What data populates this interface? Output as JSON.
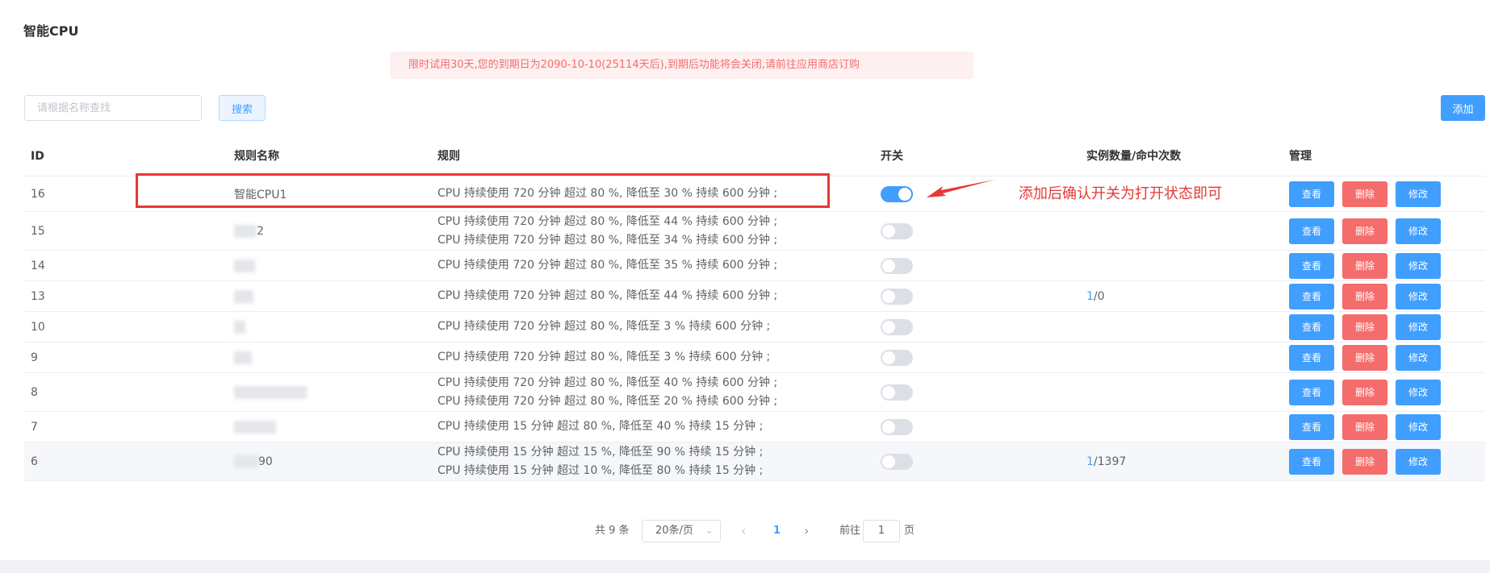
{
  "page": {
    "title": "智能CPU"
  },
  "notice": {
    "text": "限时试用30天,您的到期日为2090-10-10(25114天后),到期后功能将会关闭,请前往应用商店订购"
  },
  "toolbar": {
    "search_placeholder": "请根据名称查找",
    "search_value": "",
    "search_label": "搜索",
    "add_label": "添加"
  },
  "table": {
    "headers": {
      "id": "ID",
      "name": "规则名称",
      "rule": "规则",
      "switch": "开关",
      "count": "实例数量/命中次数",
      "ops": "管理"
    },
    "op_labels": {
      "view": "查看",
      "delete": "删除",
      "edit": "修改"
    },
    "rows": [
      {
        "id": "16",
        "name": "智能CPU1",
        "name_blurred": false,
        "rules": [
          "CPU 持续使用 720 分钟 超过 80 %, 降低至 30 % 持续 600 分钟 ;"
        ],
        "switch_on": true,
        "count_hit": "",
        "count_rest": ""
      },
      {
        "id": "15",
        "name": "2",
        "name_blurred": true,
        "rules": [
          "CPU 持续使用 720 分钟 超过 80 %, 降低至 44 % 持续 600 分钟 ;",
          "CPU 持续使用 720 分钟 超过 80 %, 降低至 34 % 持续 600 分钟 ;"
        ],
        "switch_on": false,
        "count_hit": "",
        "count_rest": ""
      },
      {
        "id": "14",
        "name": "",
        "name_blurred": true,
        "rules": [
          "CPU 持续使用 720 分钟 超过 80 %, 降低至 35 % 持续 600 分钟 ;"
        ],
        "switch_on": false,
        "count_hit": "",
        "count_rest": ""
      },
      {
        "id": "13",
        "name": "",
        "name_blurred": true,
        "rules": [
          "CPU 持续使用 720 分钟 超过 80 %, 降低至 44 % 持续 600 分钟 ;"
        ],
        "switch_on": false,
        "count_hit": "1",
        "count_rest": "/0"
      },
      {
        "id": "10",
        "name": "",
        "name_blurred": true,
        "rules": [
          "CPU 持续使用 720 分钟 超过 80 %, 降低至 3 % 持续 600 分钟 ;"
        ],
        "switch_on": false,
        "count_hit": "",
        "count_rest": ""
      },
      {
        "id": "9",
        "name": "",
        "name_blurred": true,
        "rules": [
          "CPU 持续使用 720 分钟 超过 80 %, 降低至 3 % 持续 600 分钟 ;"
        ],
        "switch_on": false,
        "count_hit": "",
        "count_rest": ""
      },
      {
        "id": "8",
        "name": "",
        "name_blurred": true,
        "rules": [
          "CPU 持续使用 720 分钟 超过 80 %, 降低至 40 % 持续 600 分钟 ;",
          "CPU 持续使用 720 分钟 超过 80 %, 降低至 20 % 持续 600 分钟 ;"
        ],
        "switch_on": false,
        "count_hit": "",
        "count_rest": ""
      },
      {
        "id": "7",
        "name": "",
        "name_blurred": true,
        "rules": [
          "CPU 持续使用 15 分钟 超过 80 %, 降低至 40 % 持续 15 分钟 ;"
        ],
        "switch_on": false,
        "count_hit": "",
        "count_rest": ""
      },
      {
        "id": "6",
        "name": "90",
        "name_blurred": true,
        "rules": [
          "CPU 持续使用 15 分钟 超过 15 %, 降低至 90 % 持续 15 分钟 ;",
          "CPU 持续使用 15 分钟 超过 10 %, 降低至 80 % 持续 15 分钟 ;"
        ],
        "switch_on": false,
        "count_hit": "1",
        "count_rest": "/1397"
      }
    ]
  },
  "annotation": {
    "text": "添加后确认开关为打开状态即可"
  },
  "pagination": {
    "total": "共 9 条",
    "page_size": "20条/页",
    "current": "1",
    "goto_prefix": "前往",
    "goto_value": "1",
    "goto_suffix": "页"
  },
  "colors": {
    "primary": "#409eff",
    "danger": "#f56c6c",
    "annotation": "#e53935",
    "notice_bg": "#fef0f0"
  }
}
